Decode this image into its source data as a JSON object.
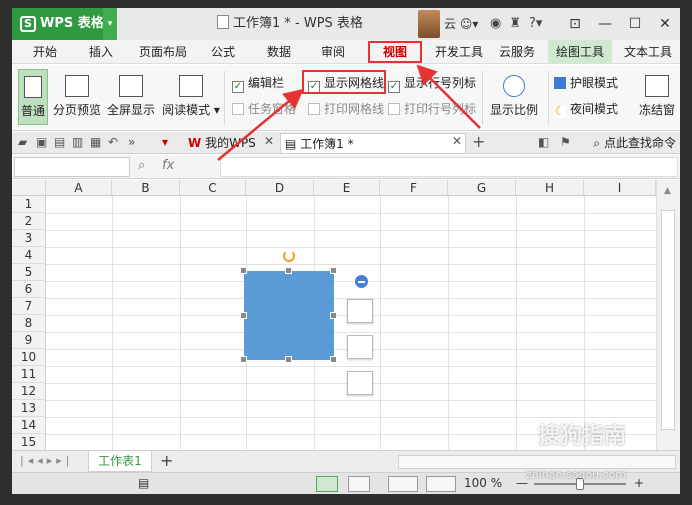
{
  "app": {
    "logo_letter": "S",
    "name": "WPS 表格",
    "window_title": "工作簿1 * - WPS 表格",
    "cloud_label": "云"
  },
  "menu_tabs": [
    "开始",
    "插入",
    "页面布局",
    "公式",
    "数据",
    "审阅",
    "视图",
    "开发工具",
    "云服务",
    "绘图工具",
    "文本工具"
  ],
  "active_tab": "视图",
  "ribbon": {
    "normal": "普通",
    "page_preview": "分页预览",
    "fullscreen": "全屏显示",
    "reading_mode": "阅读模式 ▾",
    "edit_bar": "编辑栏",
    "task_pane": "任务窗格",
    "show_gridlines": "显示网格线",
    "print_gridlines": "打印网格线",
    "show_rowcol": "显示行号列标",
    "print_rowcol": "打印行号列标",
    "zoom": "显示比例",
    "eye_mode": "护眼模式",
    "night_mode": "夜间模式",
    "freeze": "冻结窗"
  },
  "doc_tabs": {
    "my_wps": "我的WPS",
    "workbook": "工作簿1 *",
    "find_cmd": "点此查找命令"
  },
  "formula_bar": {
    "fx": "fx"
  },
  "columns": [
    "A",
    "B",
    "C",
    "D",
    "E",
    "F",
    "G",
    "H",
    "I"
  ],
  "rows": [
    "1",
    "2",
    "3",
    "4",
    "5",
    "6",
    "7",
    "8",
    "9",
    "10",
    "11",
    "12",
    "13",
    "14",
    "15"
  ],
  "sheet_tab": "工作表1",
  "status": {
    "zoom": "100 %"
  },
  "watermark": {
    "brand": "搜狗指南",
    "site": "zhinan.sogou.com"
  },
  "colors": {
    "accent": "#2f9a3f",
    "highlight_box": "#e53333",
    "shape_fill": "#5b9bd5"
  }
}
